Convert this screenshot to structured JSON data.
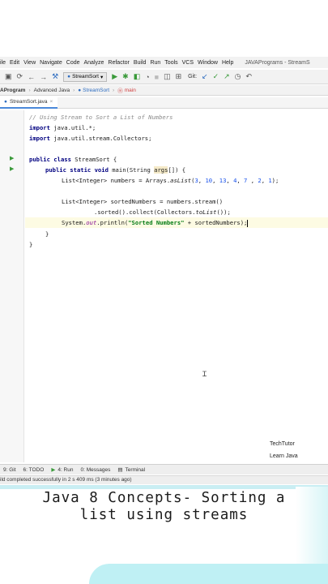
{
  "menu": {
    "items": [
      "ile",
      "Edit",
      "View",
      "Navigate",
      "Code",
      "Analyze",
      "Refactor",
      "Build",
      "Run",
      "Tools",
      "VCS",
      "Window",
      "Help"
    ],
    "window_title": "JAVAPrograms - StreamS"
  },
  "toolbar": {
    "run_config": "StreamSort",
    "git_label": "Git:"
  },
  "breadcrumb": {
    "project": "AProgram",
    "folder": "Advanced Java",
    "class": "StreamSort",
    "method": "main"
  },
  "tab": {
    "filename": "StreamSort.java"
  },
  "code": {
    "line1": "// Using Stream to Sort a List of Numbers",
    "import_kw": "import",
    "import1": " java.util.*;",
    "import2": " java.util.stream.Collectors;",
    "class_kw": "public class",
    "class_name": " StreamSort {",
    "main_mods": "public static void",
    "main_sig": " main(String ",
    "main_args": "args",
    "main_end": "[]) {",
    "numbers_decl": "List<Integer> numbers = Arrays.",
    "aslist": "asList",
    "numbers_open": "(",
    "n1": "3",
    "n2": "10",
    "n3": "13",
    "n4": "4",
    "n5": "7",
    "n6": "2",
    "n7": "1",
    "numbers_close": ");",
    "sorted_decl": "List<Integer> sortedNumbers = numbers.stream()",
    "sorted_chain": ".sorted().collect(Collectors.",
    "tolist": "toList",
    "sorted_end": "());",
    "println_pre": "System.",
    "out": "out",
    "println_mid": ".println(",
    "println_str": "\"Sorted Numbers\"",
    "println_end": " + sortedNumbers);",
    "brace_inner": "}",
    "brace_outer": "}"
  },
  "watermark": {
    "line1": "TechTutor",
    "line2": "Learn Java"
  },
  "tool_windows": [
    "9: Git",
    "6: TODO",
    "4: Run",
    "0: Messages",
    "Terminal"
  ],
  "status": {
    "message": "ild completed successfully in 2 s 409 ms (3 minutes ago)"
  },
  "caption": {
    "line1": "Java 8 Concepts- Sorting a",
    "line2": "list using streams"
  },
  "icons": [
    "save-icon",
    "sync-icon",
    "back-arrow-icon",
    "forward-arrow-icon",
    "build-hammer-icon",
    "run-icon",
    "debug-icon",
    "coverage-icon",
    "profile-icon",
    "stop-icon",
    "git-update-icon",
    "git-commit-icon",
    "history-icon",
    "revert-icon",
    "java-class-icon",
    "method-icon",
    "run-gutter-icon",
    "mouse-ibeam-icon"
  ],
  "colors": {
    "keyword": "#000080",
    "string": "#067d17",
    "number": "#1750eb",
    "comment": "#8c8c8c",
    "run_green": "#3a9a3a",
    "caption_accent": "#bff0f4"
  }
}
